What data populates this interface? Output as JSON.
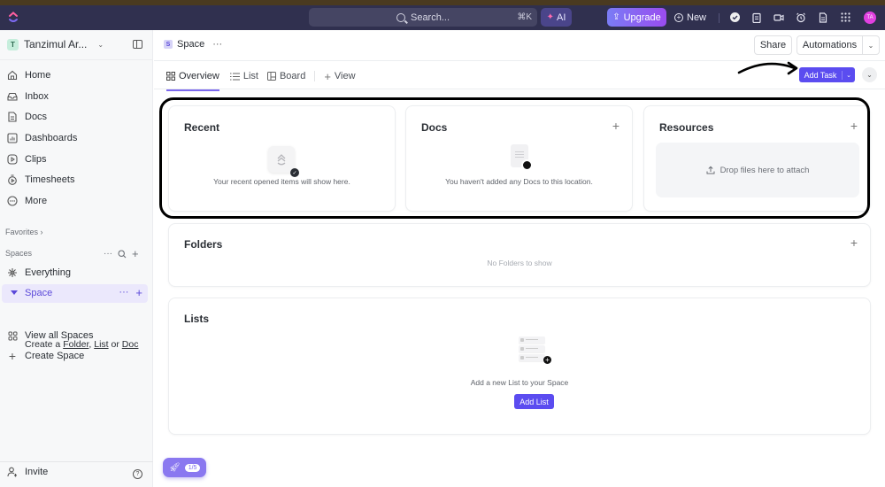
{
  "topbar": {
    "search_label": "Search...",
    "search_shortcut": "⌘K",
    "ai_label": "AI",
    "upgrade_label": "Upgrade",
    "new_label": "New",
    "icons": [
      "check-circle-icon",
      "notepad-icon",
      "video-icon",
      "alarm-icon",
      "document-icon",
      "apps-grid-icon"
    ],
    "avatar_initials": "TA",
    "avatar_color": "#e040e0"
  },
  "sidebar": {
    "workspace_initial": "T",
    "workspace_name": "Tanzimul Ar...",
    "nav": [
      {
        "label": "Home",
        "icon": "home-icon"
      },
      {
        "label": "Inbox",
        "icon": "inbox-icon"
      },
      {
        "label": "Docs",
        "icon": "docs-icon"
      },
      {
        "label": "Dashboards",
        "icon": "dashboard-icon"
      },
      {
        "label": "Clips",
        "icon": "clips-icon"
      },
      {
        "label": "Timesheets",
        "icon": "timesheet-icon"
      },
      {
        "label": "More",
        "icon": "more-icon"
      }
    ],
    "favorites_label": "Favorites",
    "spaces_label": "Spaces",
    "everything_label": "Everything",
    "active_space": "Space",
    "create_prefix": "Create a",
    "create_folder": "Folder",
    "create_list": "List",
    "create_or": "or",
    "create_doc": "Doc",
    "view_all_label": "View all Spaces",
    "create_space_label": "Create Space",
    "invite_label": "Invite",
    "accent": "#5b49d9"
  },
  "header": {
    "space_badge": "S",
    "space_name": "Space",
    "share_label": "Share",
    "automations_label": "Automations",
    "tabs": [
      {
        "label": "Overview",
        "active": true
      },
      {
        "label": "List",
        "active": false
      },
      {
        "label": "Board",
        "active": false
      }
    ],
    "add_view_label": "View",
    "add_task_label": "Add Task",
    "primary_color": "#5b4cf0"
  },
  "cards": {
    "recent": {
      "title": "Recent",
      "empty": "Your recent opened items will show here."
    },
    "docs": {
      "title": "Docs",
      "empty": "You haven't added any Docs to this location."
    },
    "resources": {
      "title": "Resources",
      "drop": "Drop files here to attach"
    },
    "folders": {
      "title": "Folders",
      "empty": "No Folders to show"
    },
    "lists": {
      "title": "Lists",
      "empty": "Add a new List to your Space",
      "button": "Add List"
    }
  },
  "onboarding": {
    "progress": "1/5"
  }
}
